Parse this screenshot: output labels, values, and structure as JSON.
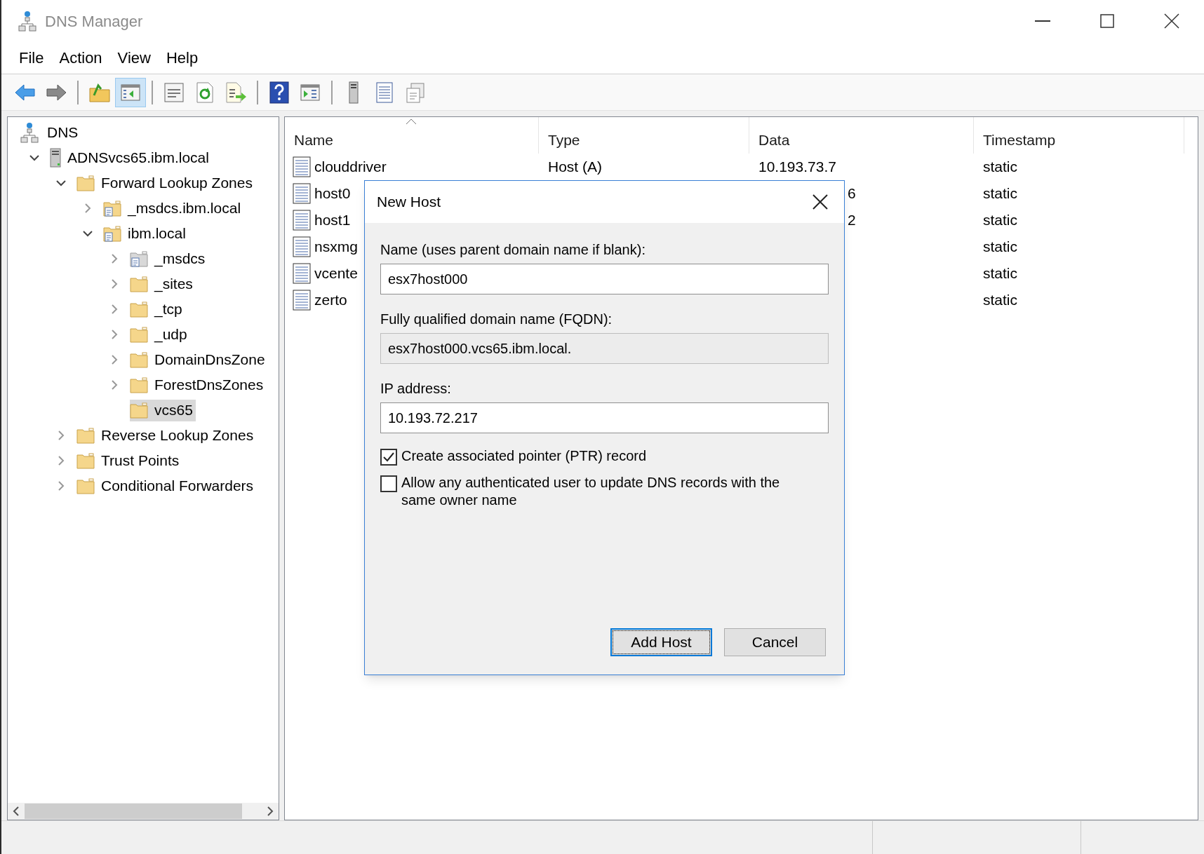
{
  "window": {
    "title": "DNS Manager"
  },
  "menu": [
    "File",
    "Action",
    "View",
    "Help"
  ],
  "toolbar_groups": [
    [
      {
        "kind": "back",
        "selected": false
      },
      {
        "kind": "forward",
        "selected": false
      }
    ],
    [
      {
        "kind": "up",
        "selected": false
      },
      {
        "kind": "tree-pane",
        "selected": true
      }
    ],
    [
      {
        "kind": "properties",
        "selected": false
      },
      {
        "kind": "refresh",
        "selected": false
      },
      {
        "kind": "export",
        "selected": false
      }
    ],
    [
      {
        "kind": "help",
        "selected": false
      },
      {
        "kind": "action-pane",
        "selected": false
      }
    ],
    [
      {
        "kind": "server",
        "selected": false
      },
      {
        "kind": "records",
        "selected": false
      },
      {
        "kind": "copy",
        "selected": false
      }
    ]
  ],
  "tree": {
    "label": "DNS",
    "selected": false,
    "children": [
      {
        "label": "ADNSvcs65.ibm.local",
        "kind": "server",
        "expandable": true,
        "expanded": true,
        "selected": false,
        "children": [
          {
            "label": "Forward Lookup Zones",
            "kind": "folder",
            "expandable": true,
            "expanded": true,
            "selected": false,
            "children": [
              {
                "label": "_msdcs.ibm.local",
                "kind": "zone",
                "expandable": true,
                "expanded": false,
                "selected": false
              },
              {
                "label": "ibm.local",
                "kind": "zone",
                "expandable": true,
                "expanded": true,
                "selected": false,
                "children": [
                  {
                    "label": "_msdcs",
                    "kind": "delegation",
                    "expandable": true,
                    "expanded": false,
                    "selected": false
                  },
                  {
                    "label": "_sites",
                    "kind": "folder",
                    "expandable": true,
                    "expanded": false,
                    "selected": false
                  },
                  {
                    "label": "_tcp",
                    "kind": "folder",
                    "expandable": true,
                    "expanded": false,
                    "selected": false
                  },
                  {
                    "label": "_udp",
                    "kind": "folder",
                    "expandable": true,
                    "expanded": false,
                    "selected": false
                  },
                  {
                    "label": "DomainDnsZone",
                    "kind": "folder",
                    "expandable": true,
                    "expanded": false,
                    "selected": false
                  },
                  {
                    "label": "ForestDnsZones",
                    "kind": "folder",
                    "expandable": true,
                    "expanded": false,
                    "selected": false
                  },
                  {
                    "label": "vcs65",
                    "kind": "folder",
                    "expandable": false,
                    "selected": true
                  }
                ]
              }
            ]
          },
          {
            "label": "Reverse Lookup Zones",
            "kind": "folder",
            "expandable": true,
            "expanded": false,
            "selected": false
          },
          {
            "label": "Trust Points",
            "kind": "folder",
            "expandable": true,
            "expanded": false,
            "selected": false
          },
          {
            "label": "Conditional Forwarders",
            "kind": "folder",
            "expandable": true,
            "expanded": false,
            "selected": false
          }
        ]
      }
    ]
  },
  "list": {
    "columns": [
      {
        "label": "Name",
        "sorted": true
      },
      {
        "label": "Type",
        "sorted": false
      },
      {
        "label": "Data",
        "sorted": false
      },
      {
        "label": "Timestamp",
        "sorted": false
      }
    ],
    "rows": [
      {
        "name": "clouddriver",
        "type": "Host (A)",
        "data": "10.193.73.7",
        "timestamp": "static",
        "covered": false
      },
      {
        "name": "host0",
        "data": "6",
        "timestamp": "static",
        "covered": true
      },
      {
        "name": "host1",
        "data": "2",
        "timestamp": "static",
        "covered": true
      },
      {
        "name": "nsxmg",
        "timestamp": "static"
      },
      {
        "name": "vcente",
        "timestamp": "static"
      },
      {
        "name": "zerto",
        "timestamp": "static"
      }
    ]
  },
  "dialog": {
    "title": "New Host",
    "fields": [
      {
        "label": "Name (uses parent domain name if blank):",
        "value": "esx7host000",
        "readonly": false
      },
      {
        "label": "Fully qualified domain name (FQDN):",
        "value": "esx7host000.vcs65.ibm.local.",
        "readonly": true
      },
      {
        "label": "IP address:",
        "value": "10.193.72.217",
        "readonly": false
      }
    ],
    "checkboxes": [
      {
        "label": "Create associated pointer (PTR) record",
        "checked": true
      },
      {
        "label": "Allow any authenticated user to update DNS records with the same owner name",
        "checked": false
      }
    ],
    "buttons": [
      {
        "label": "Add Host",
        "default": true
      },
      {
        "label": "Cancel",
        "default": false
      }
    ]
  }
}
